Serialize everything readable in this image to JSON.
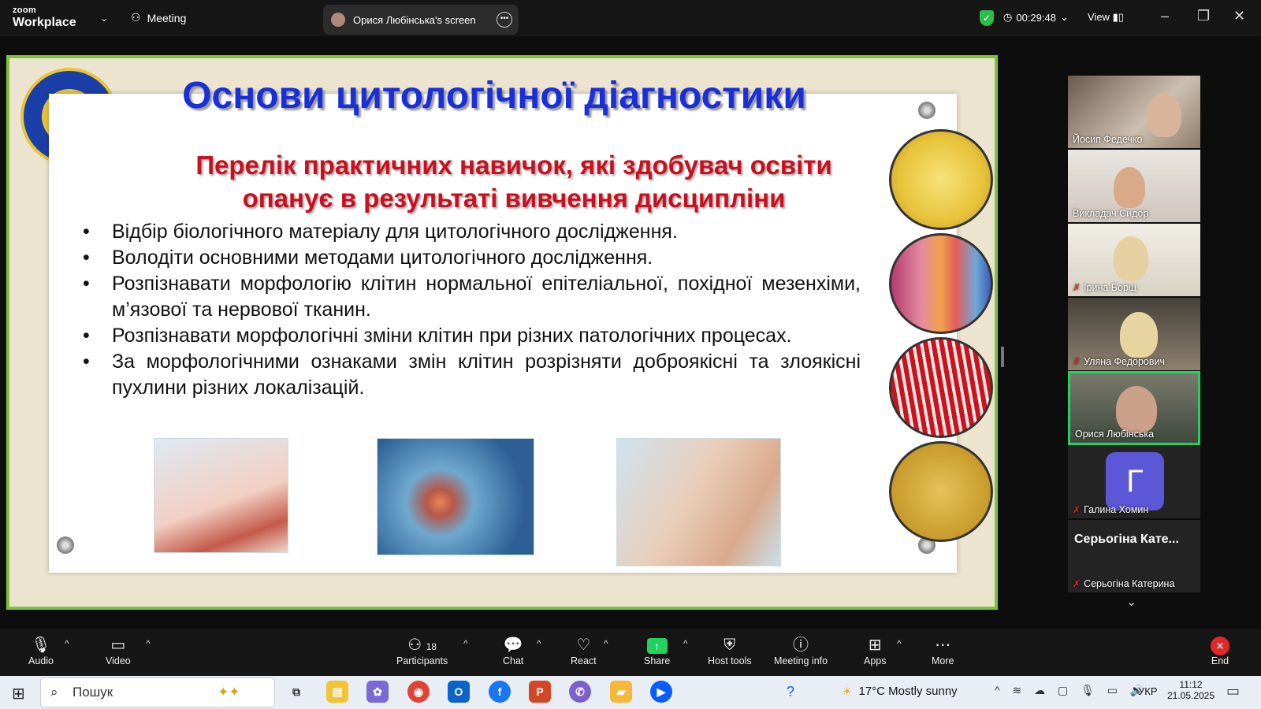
{
  "topbar": {
    "logo_small": "zoom",
    "logo_big": "Workplace",
    "meeting_label": "Meeting",
    "screen_label": "Орися Любінська's screen",
    "timer": "00:29:48",
    "view_label": "View"
  },
  "slide": {
    "title": "Основи цитологічної діагностики",
    "subtitle_line1": "Перелік практичних навичок, які здобувач освіти",
    "subtitle_line2": "опанує в результаті вивчення дисципліни",
    "bullets": [
      "Відбір біологічного матеріалу для цитологічного дослідження.",
      "Володіти основними методами цитологічного дослідження.",
      "Розпізнавати  морфологію клітин нормальної епітеліальної, похідної мезенхіми, м’язової та нервової тканин.",
      "Розпізнавати морфологічні зміни клітин  при різних  патологічних процесах.",
      "За морфологічними ознаками змін клітин розрізняти доброякісні та злоякісні пухлини різних локалізацій."
    ]
  },
  "participants": [
    {
      "name": "Йосип Федечко",
      "muted": false
    },
    {
      "name": "Викладач Сидор",
      "muted": false
    },
    {
      "name": "Ірина Борщ",
      "muted": true
    },
    {
      "name": "Уляна Федорович",
      "muted": true
    },
    {
      "name": "Орися Любінська",
      "muted": false,
      "active": true
    },
    {
      "name": "Галина Хомин",
      "muted": true,
      "avatar_letter": "Г"
    },
    {
      "name": "Серьогіна Катерина",
      "muted": true,
      "display_title": "Серьогіна Кате..."
    }
  ],
  "toolbar": {
    "audio": "Audio",
    "video": "Video",
    "participants": "Participants",
    "participants_count": "18",
    "chat": "Chat",
    "react": "React",
    "share": "Share",
    "host_tools": "Host tools",
    "meeting_info": "Meeting info",
    "apps": "Apps",
    "more": "More",
    "end": "End"
  },
  "taskbar": {
    "search_placeholder": "Пошук",
    "weather": "17°C  Mostly sunny",
    "lang": "УКР",
    "time": "11:12",
    "date": "21.05.2025"
  },
  "colors": {
    "slide_border": "#7fc13a",
    "title_blue": "#1a2fd6",
    "subtitle_red": "#c8101e",
    "active_speaker": "#23d160",
    "end_red": "#e02828"
  }
}
